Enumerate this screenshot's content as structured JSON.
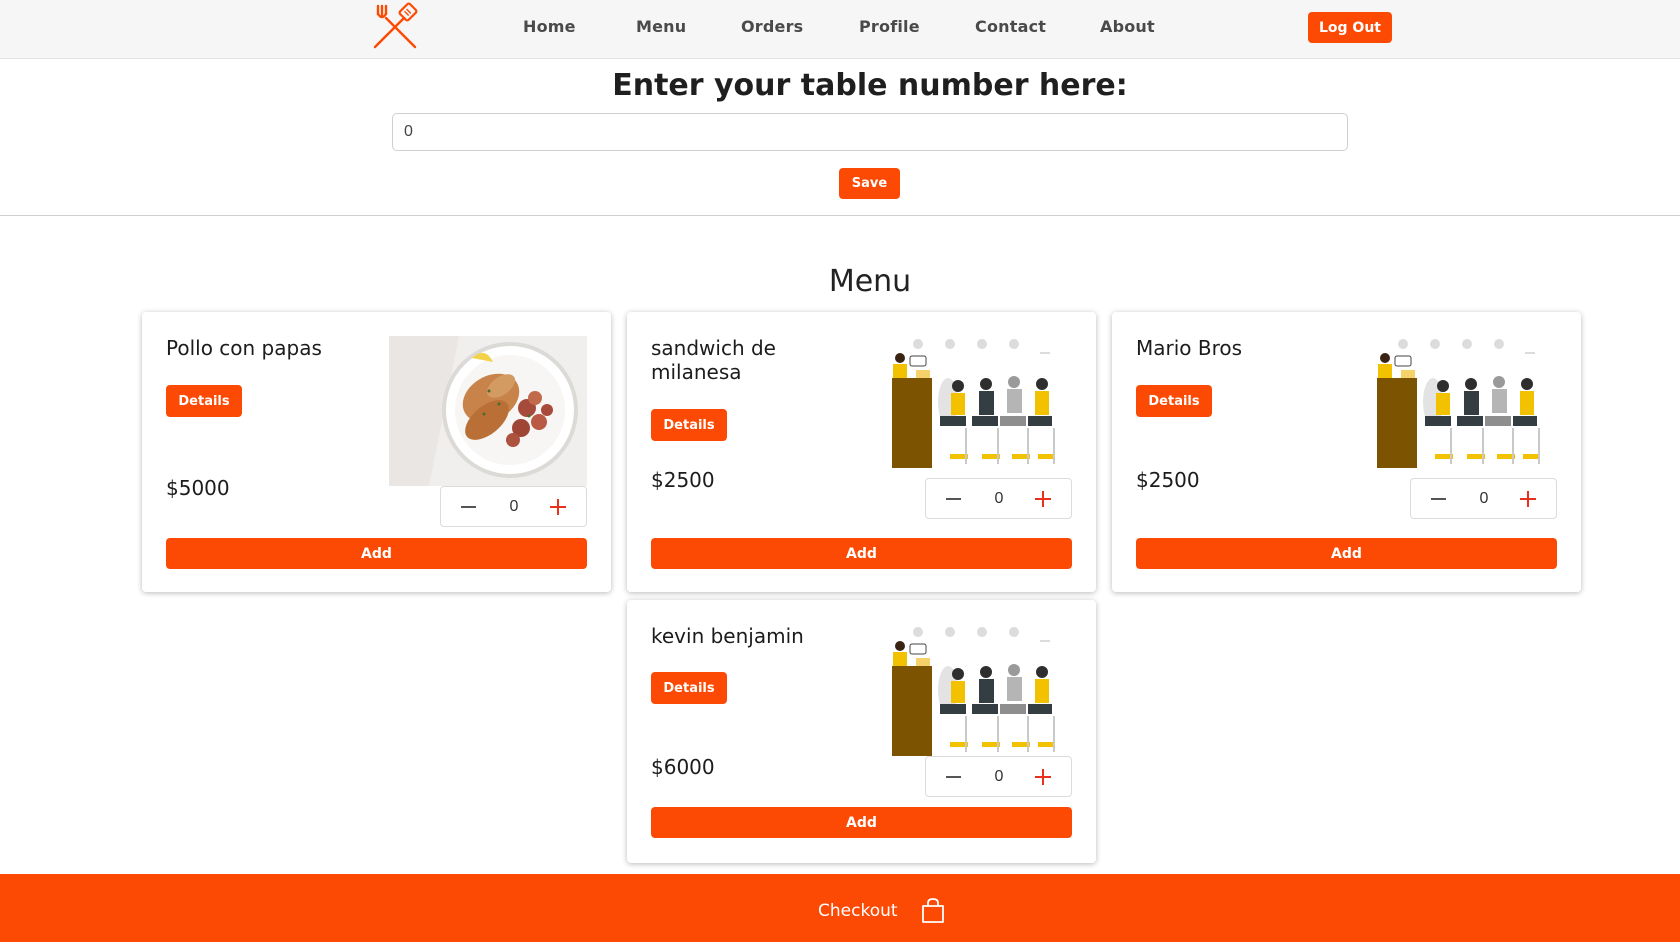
{
  "navbar": {
    "items": [
      {
        "label": "Home"
      },
      {
        "label": "Menu"
      },
      {
        "label": "Orders"
      },
      {
        "label": "Profile"
      },
      {
        "label": "Contact"
      },
      {
        "label": "About"
      }
    ],
    "logout_label": "Log Out",
    "logo_icon": "crossed-fork-spatula-icon"
  },
  "table": {
    "title": "Enter your table number here:",
    "value": "0",
    "save_label": "Save"
  },
  "menu": {
    "title": "Menu",
    "items": [
      {
        "name": "Pollo con papas",
        "details_label": "Details",
        "price": "$5000",
        "quantity": "0",
        "add_label": "Add",
        "image": "grilled-chicken-potatoes-photo"
      },
      {
        "name": "sandwich de milanesa",
        "details_label": "Details",
        "price": "$2500",
        "quantity": "0",
        "add_label": "Add",
        "image": "conference-speaker-illustration"
      },
      {
        "name": "Mario Bros",
        "details_label": "Details",
        "price": "$2500",
        "quantity": "0",
        "add_label": "Add",
        "image": "conference-speaker-illustration"
      },
      {
        "name": "kevin benjamin",
        "details_label": "Details",
        "price": "$6000",
        "quantity": "0",
        "add_label": "Add",
        "image": "conference-speaker-illustration"
      }
    ]
  },
  "checkout": {
    "label": "Checkout",
    "icon": "shopping-bag-icon"
  },
  "colors": {
    "accent": "#fc4a04",
    "plus": "#e8301c",
    "navbar_bg": "#f6f6f6"
  }
}
